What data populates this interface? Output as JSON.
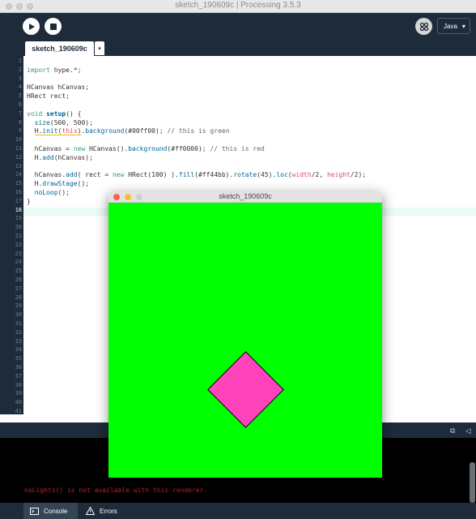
{
  "window": {
    "title": "sketch_190609c | Processing 3.5.3"
  },
  "toolbar": {
    "run_icon": "play-icon",
    "stop_icon": "stop-icon",
    "debug_icon": "debug-icon",
    "mode_label": "Java",
    "mode_arrow": "▾"
  },
  "tabs": [
    {
      "label": "sketch_190609c"
    }
  ],
  "tab_menu_glyph": "▾",
  "editor": {
    "current_line": 18,
    "line_numbers": [
      "1",
      "2",
      "3",
      "4",
      "5",
      "6",
      "7",
      "8",
      "9",
      "10",
      "11",
      "12",
      "13",
      "14",
      "15",
      "16",
      "17",
      "18",
      "19",
      "20",
      "21",
      "22",
      "23",
      "24",
      "25",
      "26",
      "27",
      "28",
      "29",
      "30",
      "31",
      "32",
      "33",
      "34",
      "35",
      "36",
      "37",
      "38",
      "39",
      "40",
      "41"
    ],
    "code": [
      "",
      "import hype.*;",
      "",
      "HCanvas hCanvas;",
      "HRect rect;",
      "",
      "void setup() {",
      "  size(500, 500);",
      "  H.init(this).background(#00ff00); // this is green",
      "",
      "  hCanvas = new HCanvas().background(#ff0000); // this is red",
      "  H.add(hCanvas);",
      "",
      "  hCanvas.add( rect = new HRect(100) ).fill(#ff44bb).rotate(45).loc(width/2, height/2);",
      "  H.drawStage();",
      "  noLoop();",
      "}",
      ""
    ]
  },
  "console": {
    "message": "noLights() is not available with this renderer."
  },
  "bottom_tabs": [
    {
      "label": "Console",
      "icon": "console-icon"
    },
    {
      "label": "Errors",
      "icon": "warning-icon"
    }
  ],
  "sketch_window": {
    "title": "sketch_190609c",
    "background_color": "#00ff00",
    "rect_fill": "#ff44bb",
    "rect_rotation_deg": 45
  },
  "colors": {
    "ide_background": "#1e2b3a",
    "current_line_highlight": "#eafaf6",
    "console_error": "#c02020",
    "close_dot": "#ff5f57",
    "minimize_dot": "#febc2e"
  }
}
